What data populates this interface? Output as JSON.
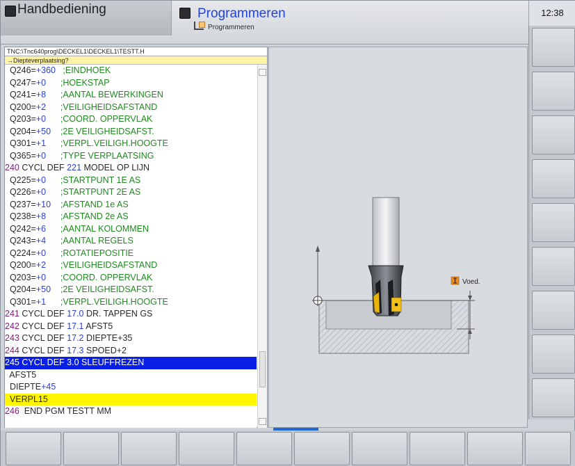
{
  "header": {
    "mode_left": "Handbediening",
    "mode_right": "Programmeren",
    "mode_right_sub": "Programmeren",
    "clock": "12:38"
  },
  "editor": {
    "path": "TNC:\\Tnc640prog\\DECKEL1\\DECKEL1\\TESTT.H",
    "prompt": "→Diepteverplaatsing?",
    "lines": [
      {
        "n": "",
        "a": "  Q246=",
        "v": "+360",
        "c": "   ;EINDHOEK",
        "t": "p"
      },
      {
        "n": "",
        "a": "  Q247=",
        "v": "+0",
        "c": "      ;HOEKSTAP",
        "t": "p"
      },
      {
        "n": "",
        "a": "  Q241=",
        "v": "+8",
        "c": "      ;AANTAL BEWERKINGEN",
        "t": "p"
      },
      {
        "n": "",
        "a": "  Q200=",
        "v": "+2",
        "c": "      ;VEILIGHEIDSAFSTAND",
        "t": "p"
      },
      {
        "n": "",
        "a": "  Q203=",
        "v": "+0",
        "c": "      ;COORD. OPPERVLAK",
        "t": "p"
      },
      {
        "n": "",
        "a": "  Q204=",
        "v": "+50",
        "c": "    ;2E VEILIGHEIDSAFST.",
        "t": "p"
      },
      {
        "n": "",
        "a": "  Q301=",
        "v": "+1",
        "c": "      ;VERPL.VEILIGH.HOOGTE",
        "t": "p"
      },
      {
        "n": "",
        "a": "  Q365=",
        "v": "+0",
        "c": "      ;TYPE VERPLAATSING",
        "t": "p"
      },
      {
        "n": "240",
        "a": " CYCL DEF ",
        "v": "221",
        "c": " MODEL OP LIJN",
        "t": "h"
      },
      {
        "n": "",
        "a": "  Q225=",
        "v": "+0",
        "c": "      ;STARTPUNT 1E AS",
        "t": "p"
      },
      {
        "n": "",
        "a": "  Q226=",
        "v": "+0",
        "c": "      ;STARTPUNT 2E AS",
        "t": "p"
      },
      {
        "n": "",
        "a": "  Q237=",
        "v": "+10",
        "c": "    ;AFSTAND 1e AS",
        "t": "p"
      },
      {
        "n": "",
        "a": "  Q238=",
        "v": "+8",
        "c": "      ;AFSTAND 2e AS",
        "t": "p"
      },
      {
        "n": "",
        "a": "  Q242=",
        "v": "+6",
        "c": "      ;AANTAL KOLOMMEN",
        "t": "p"
      },
      {
        "n": "",
        "a": "  Q243=",
        "v": "+4",
        "c": "      ;AANTAL REGELS",
        "t": "p"
      },
      {
        "n": "",
        "a": "  Q224=",
        "v": "+0",
        "c": "      ;ROTATIEPOSITIE",
        "t": "p"
      },
      {
        "n": "",
        "a": "  Q200=",
        "v": "+2",
        "c": "      ;VEILIGHEIDSAFSTAND",
        "t": "p"
      },
      {
        "n": "",
        "a": "  Q203=",
        "v": "+0",
        "c": "      ;COORD. OPPERVLAK",
        "t": "p"
      },
      {
        "n": "",
        "a": "  Q204=",
        "v": "+50",
        "c": "    ;2E VEILIGHEIDSAFST.",
        "t": "p"
      },
      {
        "n": "",
        "a": "  Q301=",
        "v": "+1",
        "c": "      ;VERPL.VEILIGH.HOOGTE",
        "t": "p"
      },
      {
        "n": "241",
        "a": " CYCL DEF ",
        "v": "17.0",
        "c": " DR. TAPPEN GS",
        "t": "h"
      },
      {
        "n": "242",
        "a": " CYCL DEF ",
        "v": "17.1",
        "c": " AFST5",
        "t": "h"
      },
      {
        "n": "243",
        "a": " CYCL DEF ",
        "v": "17.2",
        "c": " DIEPTE+35",
        "t": "h"
      },
      {
        "n": "244",
        "a": " CYCL DEF ",
        "v": "17.3",
        "c": " SPOED+2",
        "t": "h"
      },
      {
        "n": "245",
        "a": " CYCL DEF 3.0 SLEUFFREZEN",
        "v": "",
        "c": "",
        "t": "sel"
      },
      {
        "n": "",
        "a": "  AFST5",
        "v": "",
        "c": "",
        "t": "plain"
      },
      {
        "n": "",
        "a": "  DIEPTE",
        "v": "+45",
        "c": "",
        "t": "plain"
      },
      {
        "n": "",
        "a": "  VERPL15",
        "v": "",
        "c": "",
        "t": "yel"
      },
      {
        "n": "246",
        "a": "  END PGM TESTT MM",
        "v": "",
        "c": "",
        "t": "h"
      }
    ]
  },
  "graphic": {
    "feed_label": "Voed."
  }
}
